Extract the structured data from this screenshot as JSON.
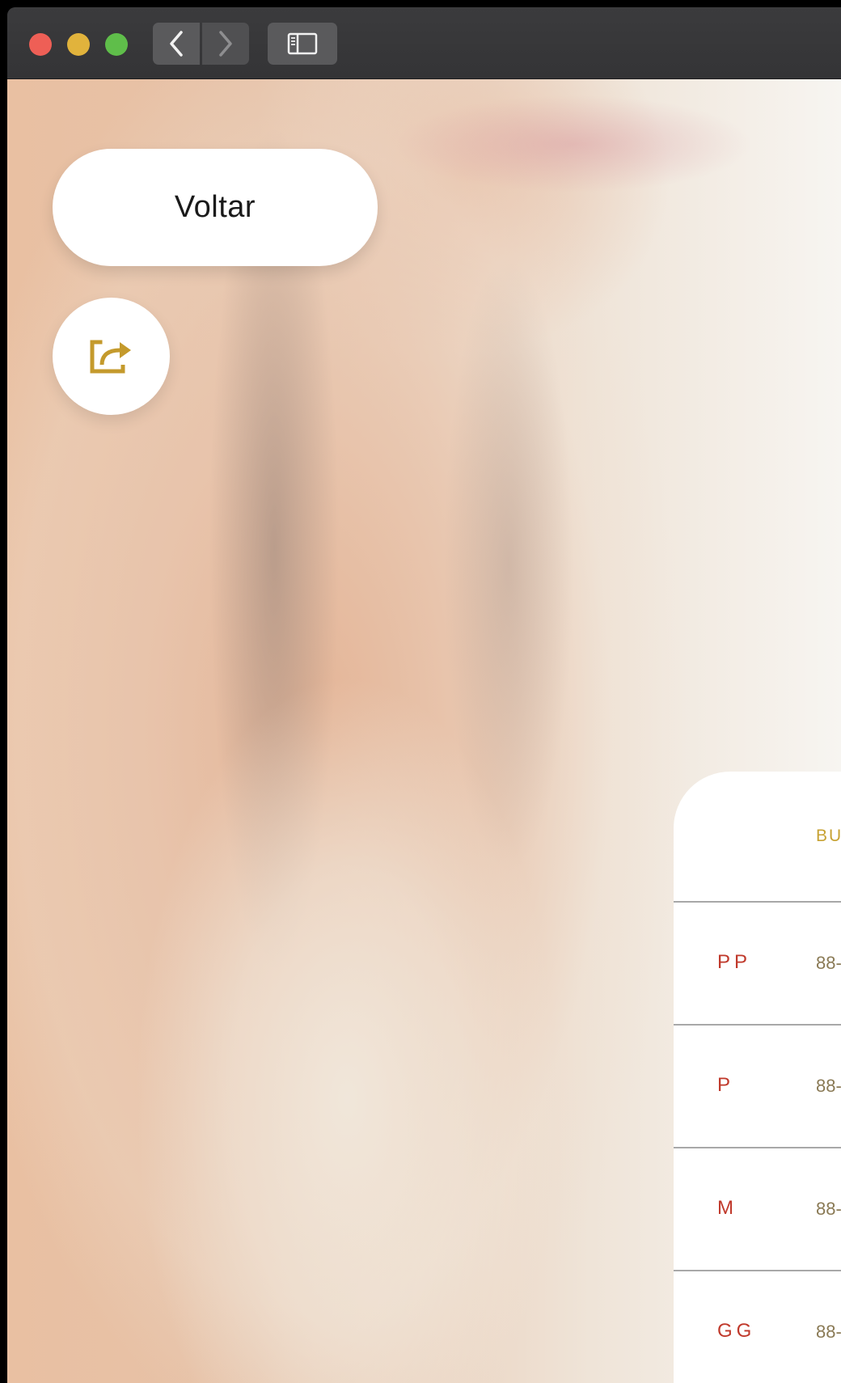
{
  "titlebar": {
    "back_icon": "chevron-left-icon",
    "forward_icon": "chevron-right-icon",
    "sidebar_icon": "sidebar-icon"
  },
  "page": {
    "back_label": "Voltar",
    "share_icon": "share-icon",
    "accent_color": "#c49a2c"
  },
  "size_table": {
    "column_header": "BU",
    "rows": [
      {
        "size": "PP",
        "bust": "88-"
      },
      {
        "size": "P",
        "bust": "88-"
      },
      {
        "size": "M",
        "bust": "88-"
      },
      {
        "size": "GG",
        "bust": "88-"
      }
    ]
  }
}
